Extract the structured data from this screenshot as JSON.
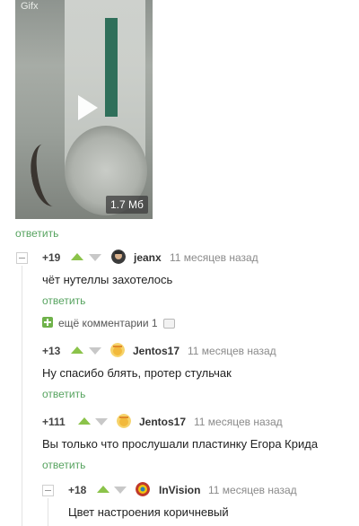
{
  "gif": {
    "label": "Gifx",
    "size": "1.7 Мб"
  },
  "post_reply": "ответить",
  "more_comments": {
    "label": "ещё комментарии",
    "count": "1"
  },
  "comments": [
    {
      "rating": "+19",
      "nick": "jeanx",
      "time": "11 месяцев назад",
      "text": "чёт нутеллы захотелось",
      "reply": "ответить"
    },
    {
      "rating": "+13",
      "nick": "Jentos17",
      "time": "11 месяцев назад",
      "text": "Ну спасибо блять, протер стульчак",
      "reply": "ответить"
    },
    {
      "rating": "+111",
      "nick": "Jentos17",
      "time": "11 месяцев назад",
      "text": "Вы только что прослушали пластинку Егора Крида",
      "reply": "ответить"
    },
    {
      "rating": "+18",
      "nick": "InVision",
      "time": "11 месяцев назад",
      "text": "Цвет настроения коричневый"
    }
  ],
  "colors": {
    "accent": "#56a35f",
    "vote_up": "#8bc34a",
    "vote_down": "#c8c8c8"
  },
  "icons": [
    "play-icon",
    "collapse-icon",
    "upvote-icon",
    "downvote-icon",
    "expand-icon",
    "comment-bubble-icon"
  ]
}
